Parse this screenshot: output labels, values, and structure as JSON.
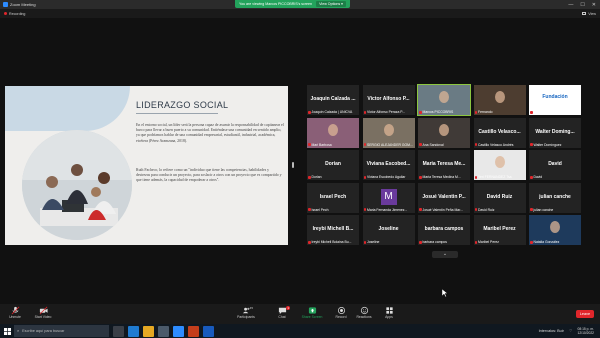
{
  "window": {
    "app_title": "Zoom Meeting",
    "minimize": "—",
    "maximize": "☐",
    "close": "✕"
  },
  "recording": {
    "label": "Recording"
  },
  "view": {
    "label": "View"
  },
  "share_banner": {
    "text": "You are viewing Marcos PICCOBRIS's screen",
    "view_options": "View Options ▾"
  },
  "slide": {
    "title": "LIDERAZGO SOCIAL",
    "paragraph1": "En el entorno social, un líder será la persona capaz de asumir la responsabilidad de capitanear el barco para llevar a buen puerto a su comunidad. Entiéndase una comunidad en sentido amplio, ya que podríamos hablar de una comunidad empresarial, estudiantil, industrial, académica, etcétera (Pérez Aramzana, 2018).",
    "paragraph2": "Ruth Pacheco, lo refiere como un \"individuo que tiene las competencias, habilidades y destrezas para conducir un proyecto, para soslacir a otros con un proyecto que es compartido y que tiene además, la capacidad de empoderar a otros\"."
  },
  "participants": [
    {
      "name": "Joaquin Calzada ...",
      "label": "Joaquín Calzada | UNICVA",
      "video": false
    },
    {
      "name": "Victor Alfonso P...",
      "label": "Victor Alfonso Peraza P...",
      "video": false
    },
    {
      "name": "",
      "label": "Marcos PICCOBRIS",
      "video": true,
      "active": true,
      "color": "#6a7b84"
    },
    {
      "name": "",
      "label": "Fernando",
      "video": true,
      "color": "#4d3d30"
    },
    {
      "name": "",
      "label": "Fundación",
      "video": true,
      "logo": "Fundación",
      "color": "#ffffff"
    },
    {
      "name": "",
      "label": "Mari Barbosa",
      "video": true,
      "color": "#8a5f77"
    },
    {
      "name": "",
      "label": "SERGIO ALEJANDER GOM...",
      "video": true,
      "color": "#7a7062"
    },
    {
      "name": "",
      "label": "Ana Sandoval",
      "video": true,
      "color": "#403a37"
    },
    {
      "name": "Castillo Velasco...",
      "label": "Castillo Velasco Andrés",
      "video": false
    },
    {
      "name": "Walter Doming...",
      "label": "Walter Domínguez",
      "video": false
    },
    {
      "name": "Dorian",
      "label": "Dorian",
      "video": false
    },
    {
      "name": "Viviana Escobed...",
      "label": "Viviana Escobedo Aguilar",
      "video": false
    },
    {
      "name": "Maria Teresa Me...",
      "label": "Maria Teresa Medina M...",
      "video": false
    },
    {
      "name": "",
      "label": "Yeri FERNANDEZ Tsa",
      "video": true,
      "color": "#e8e8e8"
    },
    {
      "name": "David",
      "label": "David",
      "video": false
    },
    {
      "name": "Israel Pech",
      "label": "Israel Pech",
      "video": false
    },
    {
      "name": "",
      "label": "Maria Fernanda Jimenez...",
      "video": true,
      "mbox": "M"
    },
    {
      "name": "Josué Valentin P...",
      "label": "Josué Valentín Peña Mar...",
      "video": false
    },
    {
      "name": "David Ruiz",
      "label": "David Ruiz",
      "video": false
    },
    {
      "name": "julian canche",
      "label": "julian canche",
      "video": false
    },
    {
      "name": "Ireybi Michell B...",
      "label": "Ireybi Michell Bolaina Bu...",
      "video": false
    },
    {
      "name": "Joseline",
      "label": "Joseline",
      "video": false
    },
    {
      "name": "barbara campos",
      "label": "barbara campos",
      "video": false
    },
    {
      "name": "Maribel Perez",
      "label": "Maribel Perez",
      "video": false
    },
    {
      "name": "",
      "label": "Natalia González",
      "video": true,
      "color": "#1e3a5c"
    }
  ],
  "toolbar": {
    "unmute": "Unmute",
    "start_video": "Start Video",
    "participants": "Participants",
    "participants_count": "45",
    "chat": "Chat",
    "chat_badge": "1",
    "share_screen": "Share Screen",
    "record": "Record",
    "reactions": "Reactions",
    "apps": "Apps",
    "leave": "Leave"
  },
  "taskbar": {
    "search_placeholder": "Escribe aquí para buscar",
    "tray_text": "Intervalos: Buir",
    "time": "08:15 p. m.",
    "date": "12/10/2022"
  },
  "colors": {
    "accent_green": "#23a35c",
    "leave_red": "#e0262b",
    "active_speaker": "#8cc63f"
  }
}
